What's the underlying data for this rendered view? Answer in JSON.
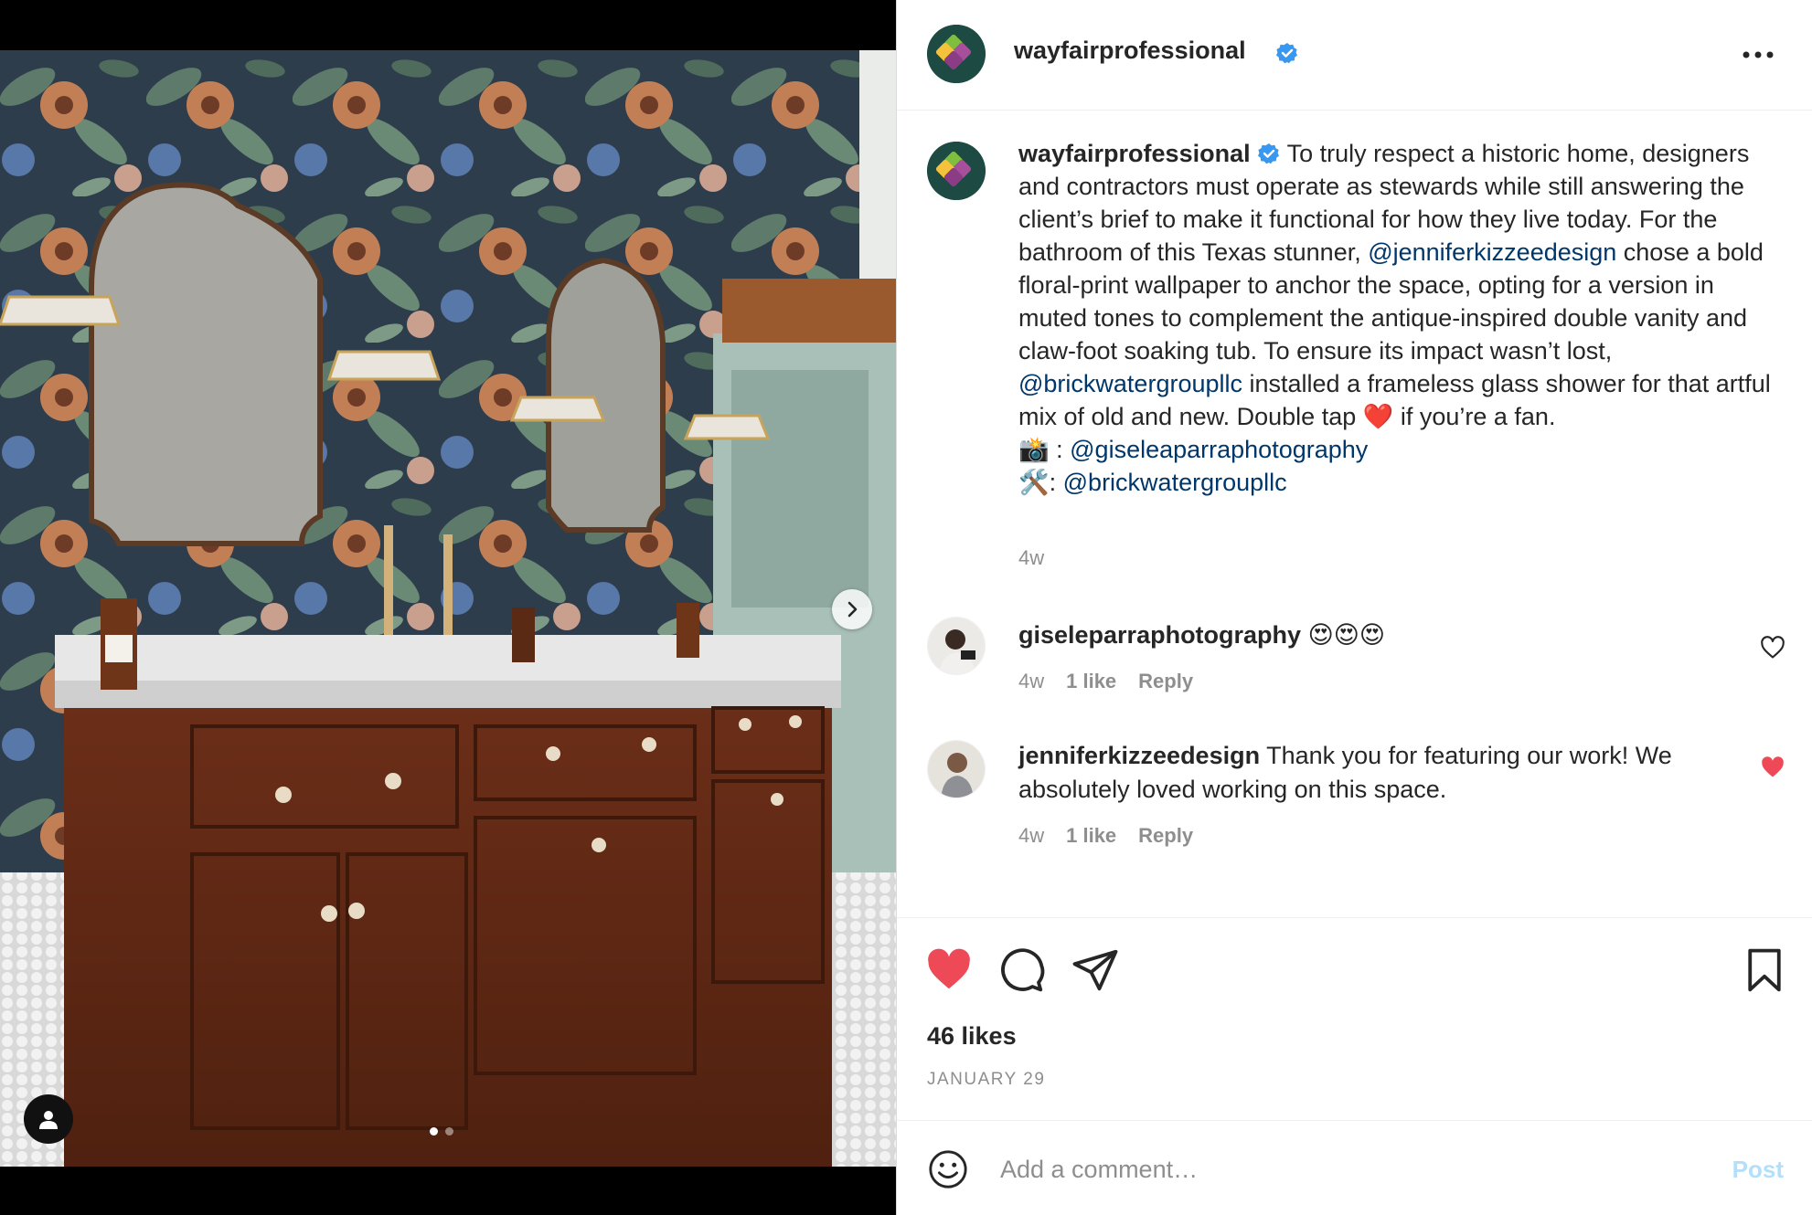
{
  "post": {
    "username": "wayfairprofessional",
    "caption_segments": [
      {
        "type": "text",
        "text": "To truly respect a historic home, designers and contractors must operate as stewards while still answering the client’s brief to make it functional for how they live today. For the bathroom of this Texas stunner, "
      },
      {
        "type": "mention",
        "text": "@jenniferkizzeedesign"
      },
      {
        "type": "text",
        "text": " chose a bold floral-print wallpaper to anchor the space, opting for a version in muted tones to complement the antique-inspired double vanity and claw-foot soaking tub. To ensure its impact wasn’t lost, "
      },
      {
        "type": "mention",
        "text": "@brickwatergroupllc"
      },
      {
        "type": "text",
        "text": " installed a frameless glass shower for that artful mix of old and new. Double tap ❤️ if you’re a fan."
      }
    ],
    "credits": [
      {
        "emoji": "📸",
        "sep": " : ",
        "mention": "@giseleaparraphotography"
      },
      {
        "emoji": "🛠️",
        "sep": ": ",
        "mention": "@brickwatergroupllc"
      }
    ],
    "caption_time": "4w",
    "likes": "46 likes",
    "date": "JANUARY 29",
    "liked": true
  },
  "comments": [
    {
      "username": "giseleparraphotography",
      "text": "😍😍😍",
      "time": "4w",
      "likes": "1 like",
      "reply": "Reply",
      "liked": false
    },
    {
      "username": "jenniferkizzeedesign",
      "text": "Thank you for featuring our work! We absolutely loved working on this space.",
      "time": "4w",
      "likes": "1 like",
      "reply": "Reply",
      "liked": true
    }
  ],
  "composer": {
    "placeholder": "Add a comment…",
    "post_label": "Post"
  },
  "icons": {
    "more": "more-options-icon",
    "like": "heart-icon",
    "comment": "comment-icon",
    "share": "share-icon",
    "save": "bookmark-icon",
    "emoji": "emoji-icon",
    "next": "chevron-right-icon",
    "tag": "user-tag-icon",
    "verified": "verified-badge-icon"
  },
  "colors": {
    "accent_blue": "#0095f6",
    "mention": "#00376b",
    "like_red": "#ed4956",
    "muted": "#8e8e8e",
    "verified": "#3897f0"
  },
  "media": {
    "slide_count": 2,
    "active_slide": 1
  }
}
